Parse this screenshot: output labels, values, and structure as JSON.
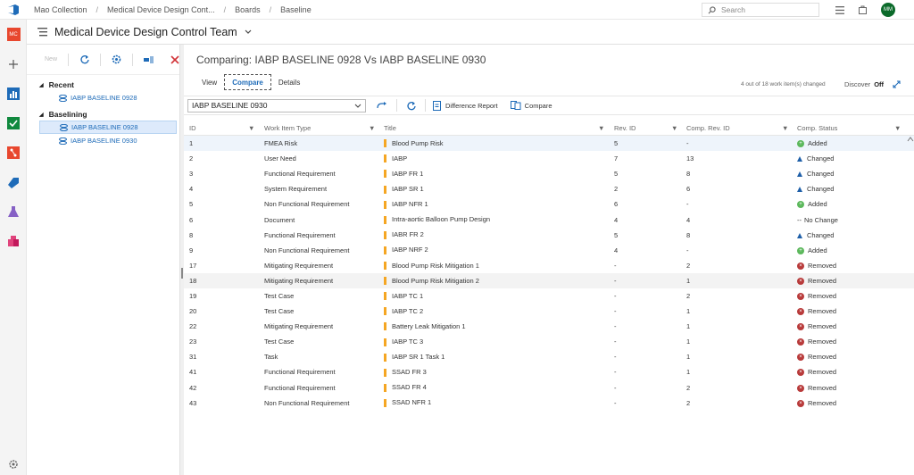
{
  "topbar": {
    "collection": "Mao Collection",
    "project": "Medical Device Design Cont...",
    "section": "Boards",
    "page": "Baseline",
    "search_placeholder": "Search",
    "avatar": "MM"
  },
  "leftnav": {
    "project_badge": "MC"
  },
  "team": {
    "title": "Medical Device Design Control Team"
  },
  "tree": {
    "new_label": "New",
    "recent_label": "Recent",
    "baselining_label": "Baselining",
    "recent_items": [
      "IABP BASELINE 0928"
    ],
    "baselining_items": [
      "IABP BASELINE 0928",
      "IABP BASELINE 0930"
    ]
  },
  "main": {
    "comparing_title": "Comparing: IABP BASELINE 0928 Vs IABP BASELINE 0930",
    "tabs": [
      "View",
      "Compare",
      "Details"
    ],
    "status_text": "4 out of 18 work item(s) changed",
    "discover_label": "Discover",
    "discover_value": "Off"
  },
  "toolbar": {
    "selected_baseline": "IABP BASELINE 0930",
    "difference_report": "Difference Report",
    "compare": "Compare"
  },
  "columns": {
    "id": "ID",
    "type": "Work Item Type",
    "title": "Title",
    "rev": "Rev. ID",
    "comp_rev": "Comp. Rev. ID",
    "status": "Comp. Status"
  },
  "rows": [
    {
      "id": "1",
      "type": "FMEA Risk",
      "title": "Blood Pump Risk",
      "rev": "5",
      "comp": "-",
      "status": "Added",
      "kind": "added"
    },
    {
      "id": "2",
      "type": "User Need",
      "title": "IABP",
      "rev": "7",
      "comp": "13",
      "status": "Changed",
      "kind": "changed"
    },
    {
      "id": "3",
      "type": "Functional Requirement",
      "title": "IABP FR 1",
      "rev": "5",
      "comp": "8",
      "status": "Changed",
      "kind": "changed"
    },
    {
      "id": "4",
      "type": "System Requirement",
      "title": "IABP SR 1",
      "rev": "2",
      "comp": "6",
      "status": "Changed",
      "kind": "changed"
    },
    {
      "id": "5",
      "type": "Non Functional Requirement",
      "title": "IABP NFR 1",
      "rev": "6",
      "comp": "-",
      "status": "Added",
      "kind": "added"
    },
    {
      "id": "6",
      "type": "Document",
      "title": "Intra-aortic Balloon Pump Design",
      "rev": "4",
      "comp": "4",
      "status": "No Change",
      "kind": "nochange"
    },
    {
      "id": "8",
      "type": "Functional Requirement",
      "title": "IABR FR 2",
      "rev": "5",
      "comp": "8",
      "status": "Changed",
      "kind": "changed"
    },
    {
      "id": "9",
      "type": "Non Functional Requirement",
      "title": "IABP NRF 2",
      "rev": "4",
      "comp": "-",
      "status": "Added",
      "kind": "added"
    },
    {
      "id": "17",
      "type": "Mitigating Requirement",
      "title": "Blood Pump Risk Mitigation 1",
      "rev": "-",
      "comp": "2",
      "status": "Removed",
      "kind": "removed"
    },
    {
      "id": "18",
      "type": "Mitigating Requirement",
      "title": "Blood Pump Risk Mitigation 2",
      "rev": "-",
      "comp": "1",
      "status": "Removed",
      "kind": "removed"
    },
    {
      "id": "19",
      "type": "Test Case",
      "title": "IABP TC 1",
      "rev": "-",
      "comp": "2",
      "status": "Removed",
      "kind": "removed"
    },
    {
      "id": "20",
      "type": "Test Case",
      "title": "IABP TC 2",
      "rev": "-",
      "comp": "1",
      "status": "Removed",
      "kind": "removed"
    },
    {
      "id": "22",
      "type": "Mitigating Requirement",
      "title": "Battery Leak Mitigation 1",
      "rev": "-",
      "comp": "1",
      "status": "Removed",
      "kind": "removed"
    },
    {
      "id": "23",
      "type": "Test Case",
      "title": "IABP TC 3",
      "rev": "-",
      "comp": "1",
      "status": "Removed",
      "kind": "removed"
    },
    {
      "id": "31",
      "type": "Task",
      "title": "IABP SR 1 Task 1",
      "rev": "-",
      "comp": "1",
      "status": "Removed",
      "kind": "removed"
    },
    {
      "id": "41",
      "type": "Functional Requirement",
      "title": "SSAD FR 3",
      "rev": "-",
      "comp": "1",
      "status": "Removed",
      "kind": "removed"
    },
    {
      "id": "42",
      "type": "Functional Requirement",
      "title": "SSAD FR 4",
      "rev": "-",
      "comp": "2",
      "status": "Removed",
      "kind": "removed"
    },
    {
      "id": "43",
      "type": "Non Functional Requirement",
      "title": "SSAD NFR 1",
      "rev": "-",
      "comp": "2",
      "status": "Removed",
      "kind": "removed"
    }
  ],
  "colors": {
    "accent": "#1e6bb8",
    "added": "#5cb85c",
    "removed": "#b83a3a",
    "changed": "#1f5fa8",
    "workitem": "#f5a623"
  }
}
